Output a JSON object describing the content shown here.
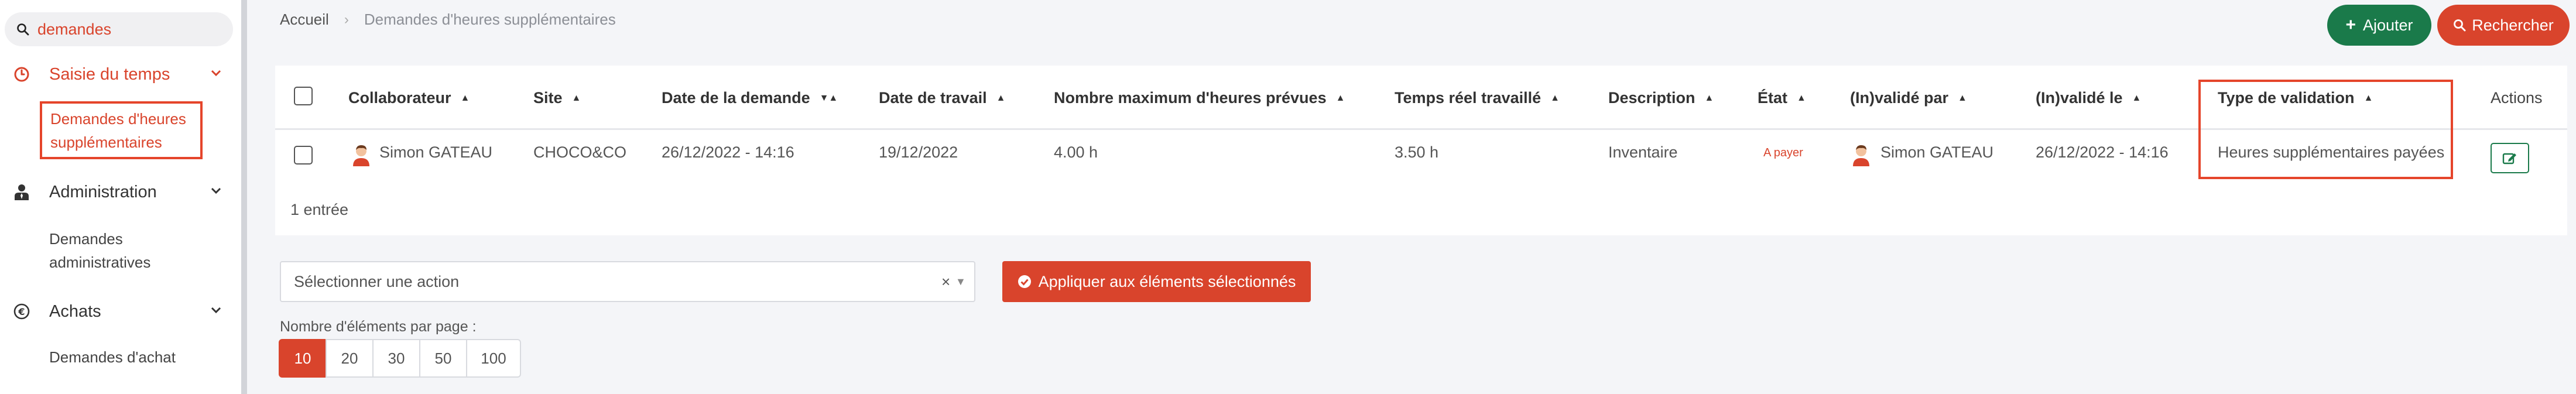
{
  "sidebar": {
    "search_value": "demandes",
    "sections": [
      {
        "label": "Saisie du temps",
        "icon": "clock-icon",
        "color": "#d9442c"
      },
      {
        "label": "Administration",
        "icon": "person-tie-icon",
        "color": "#333333"
      },
      {
        "label": "Achats",
        "icon": "euro-icon",
        "color": "#333333"
      }
    ],
    "active_item": {
      "line1": "Demandes d'heures",
      "line2": "supplémentaires"
    },
    "admin_item": {
      "line1": "Demandes",
      "line2": "administratives"
    },
    "achats_item": "Demandes d'achat"
  },
  "breadcrumb": {
    "home": "Accueil",
    "separator": "›",
    "current": "Demandes d'heures supplémentaires"
  },
  "toolbar": {
    "add_label": "Ajouter",
    "search_label": "Rechercher"
  },
  "table": {
    "headers": [
      "Collaborateur",
      "Site",
      "Date de la demande",
      "Date de travail",
      "Nombre maximum d'heures prévues",
      "Temps réel travaillé",
      "Description",
      "État",
      "(In)validé par",
      "(In)validé le",
      "Type de validation",
      "Actions"
    ],
    "rows": [
      {
        "collaborateur": "Simon GATEAU",
        "site": "CHOCO&CO",
        "date_demande": "26/12/2022 - 14:16",
        "date_travail": "19/12/2022",
        "max_heures": "4.00 h",
        "temps_reel": "3.50 h",
        "description": "Inventaire",
        "etat": "A payer",
        "valide_par": "Simon GATEAU",
        "valide_le": "26/12/2022 - 14:16",
        "type_validation": "Heures supplémentaires payées"
      }
    ],
    "count_label": "1 entrée"
  },
  "bulk": {
    "select_placeholder": "Sélectionner une action",
    "clear": "×",
    "apply_label": "Appliquer aux éléments sélectionnés"
  },
  "pagination": {
    "label": "Nombre d'éléments par page :",
    "options": [
      "10",
      "20",
      "30",
      "50",
      "100"
    ],
    "selected": "10"
  },
  "colors": {
    "accent": "#d9442c",
    "success": "#1a7a4a",
    "highlight": "#e5452b"
  }
}
